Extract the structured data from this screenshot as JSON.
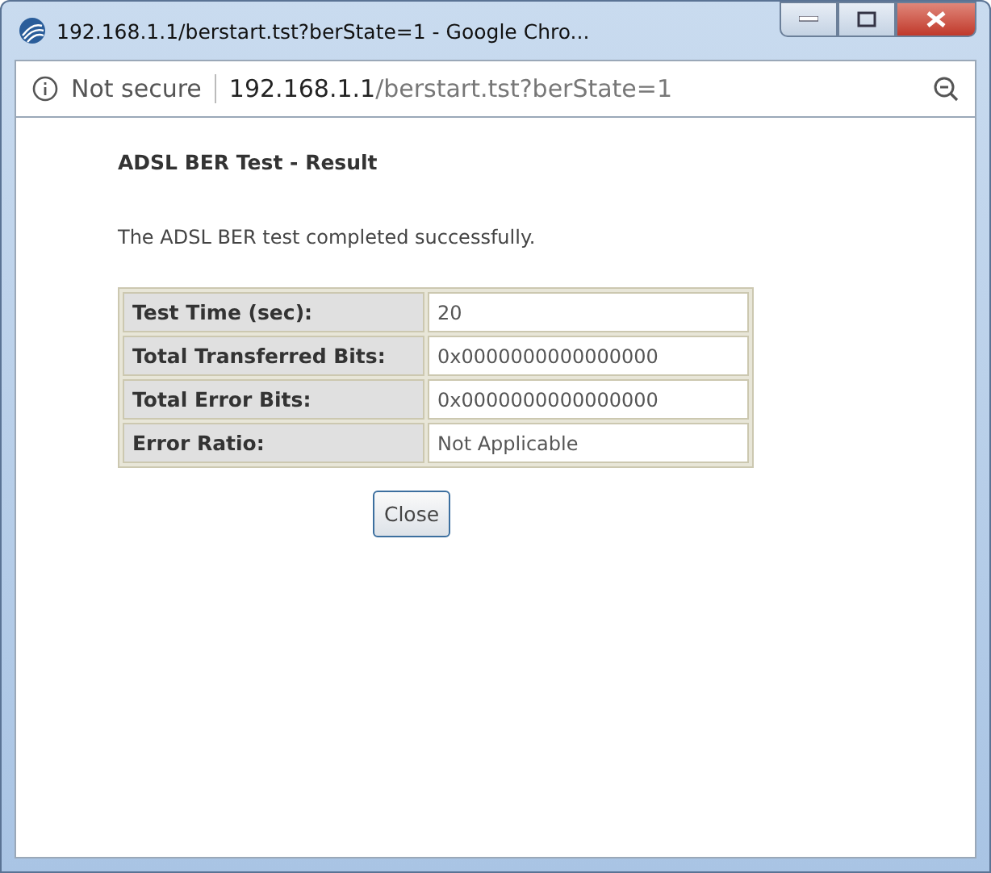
{
  "window": {
    "title": "192.168.1.1/berstart.tst?berState=1 - Google Chro..."
  },
  "address_bar": {
    "security": "Not secure",
    "url_host": "192.168.1.1",
    "url_path": "/berstart.tst?berState=1"
  },
  "page": {
    "heading": "ADSL BER Test - Result",
    "message": "The ADSL BER test completed successfully.",
    "table": {
      "rows": [
        {
          "label": "Test Time (sec):",
          "value": "20"
        },
        {
          "label": "Total Transferred Bits:",
          "value": "0x0000000000000000"
        },
        {
          "label": "Total Error Bits:",
          "value": "0x0000000000000000"
        },
        {
          "label": "Error Ratio:",
          "value": "Not Applicable"
        }
      ]
    },
    "buttons": [
      "Close"
    ]
  }
}
